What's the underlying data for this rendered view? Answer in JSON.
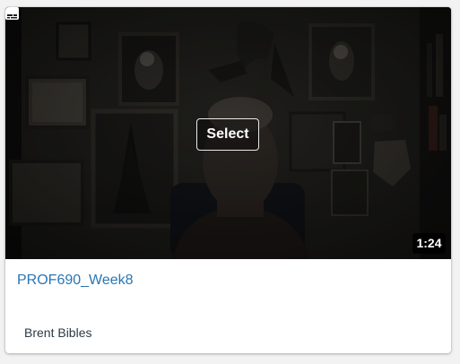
{
  "video": {
    "title": "PROF690_Week8",
    "author": "Brent Bibles",
    "duration": "1:24",
    "select_label": "Select",
    "captions_icon": "closed-captions-icon"
  },
  "colors": {
    "title_link": "#2a75b3",
    "author_text": "#2d3b45",
    "badge_bg": "#000000",
    "card_bg": "#ffffff",
    "page_bg": "#f2f2f2"
  }
}
